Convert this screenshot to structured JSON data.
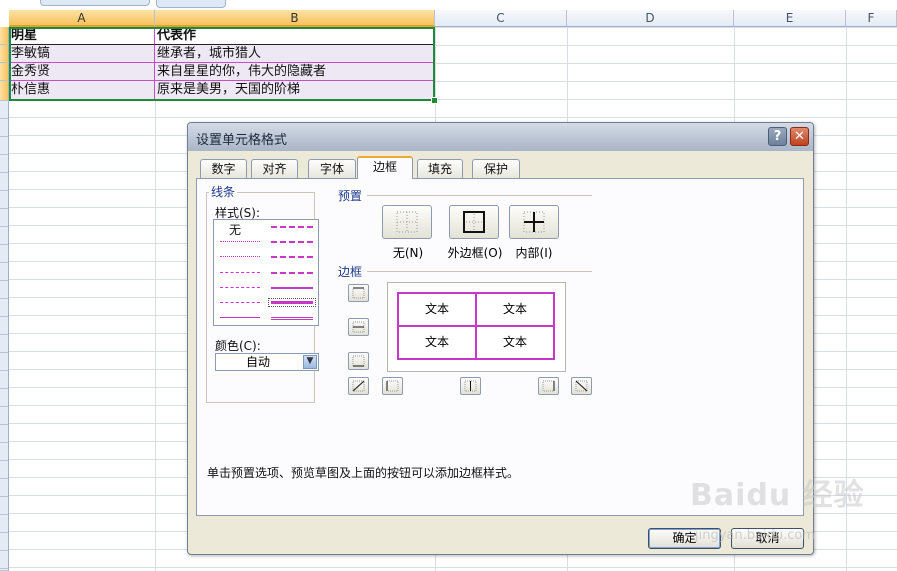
{
  "sheet": {
    "top_label": "字体",
    "columns": [
      "A",
      "B",
      "C",
      "D",
      "E",
      "F"
    ],
    "rows": [
      [
        "明星",
        "代表作"
      ],
      [
        "李敏镐",
        "继承者，城市猎人"
      ],
      [
        "金秀贤",
        "来自星星的你，伟大的隐藏者"
      ],
      [
        "朴信惠",
        "原来是美男，天国的阶梯"
      ]
    ]
  },
  "dialog": {
    "title": "设置单元格格式",
    "help": "?",
    "close": "✕",
    "tabs": [
      "数字",
      "对齐",
      "字体",
      "边框",
      "填充",
      "保护"
    ],
    "active_tab": "边框",
    "line_group_label": "线条",
    "style_label": "样式(S):",
    "none_style": "无",
    "color_label": "颜色(C):",
    "color_value": "自动",
    "presets_label": "预置",
    "presets": [
      "无(N)",
      "外边框(O)",
      "内部(I)"
    ],
    "border_label": "边框",
    "preview_text": [
      "文本",
      "文本",
      "文本",
      "文本"
    ],
    "hint": "单击预置选项、预览草图及上面的按钮可以添加边框样式。",
    "ok": "确定",
    "cancel": "取消",
    "line_color": "#c837c8"
  },
  "watermark": {
    "logo": "Baidu 经验",
    "url": "jingyan.baidu.com"
  }
}
